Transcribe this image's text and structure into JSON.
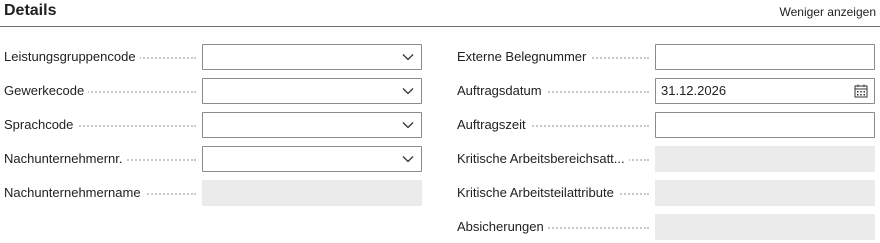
{
  "header": {
    "title": "Details",
    "toggle_link": "Weniger anzeigen"
  },
  "left_fields": [
    {
      "label": "Leistungsgruppencode",
      "value": "",
      "type": "dropdown"
    },
    {
      "label": "Gewerkecode",
      "value": "",
      "type": "dropdown"
    },
    {
      "label": "Sprachcode",
      "value": "",
      "type": "dropdown"
    },
    {
      "label": "Nachunternehmernr.",
      "value": "",
      "type": "dropdown"
    },
    {
      "label": "Nachunternehmername",
      "value": "",
      "type": "readonly"
    }
  ],
  "right_fields": [
    {
      "label": "Externe Belegnummer",
      "value": "",
      "type": "text"
    },
    {
      "label": "Auftragsdatum",
      "value": "31.12.2026",
      "type": "date"
    },
    {
      "label": "Auftragszeit",
      "value": "",
      "type": "text"
    },
    {
      "label": "Kritische Arbeitsbereichsatt...",
      "value": "",
      "type": "readonly"
    },
    {
      "label": "Kritische Arbeitsteilattribute",
      "value": "",
      "type": "readonly"
    },
    {
      "label": "Absicherungen",
      "value": "",
      "type": "readonly"
    }
  ],
  "icons": {
    "dropdown": "chevron-down-icon",
    "date": "calendar-icon"
  }
}
